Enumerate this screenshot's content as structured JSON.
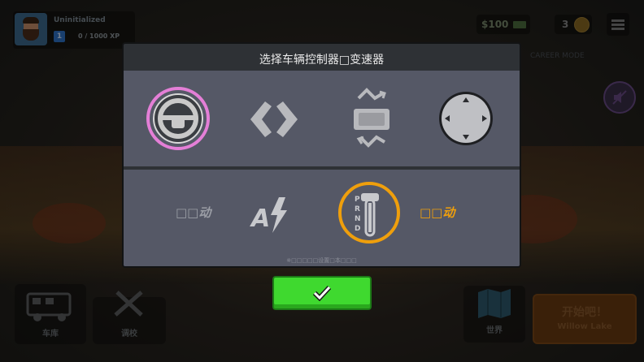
{
  "player": {
    "name": "Uninitialized",
    "level": "1",
    "xp": "0 / 1000 XP"
  },
  "currency": {
    "money": "$100",
    "coins": "3"
  },
  "side": {
    "text": "CAREER MODE"
  },
  "dialog": {
    "title": "选择车辆控制器□变速器",
    "steering_options": [
      "steering-wheel",
      "arrows",
      "tilt",
      "joystick"
    ],
    "manual_label": "□□动",
    "auto_label": "□□动",
    "hint": "※□□□□□设置□本□□□",
    "selected_steering": "steering-wheel",
    "selected_transmission": "auto"
  },
  "gear_letters": [
    "P",
    "R",
    "N",
    "D"
  ],
  "bottom": {
    "garage_label": "车库",
    "tune_label": "调校",
    "world_label": "世界",
    "go_line1": "开始吧！",
    "go_line2": "Willow Lake"
  },
  "colors": {
    "accent_pink": "#e47fd7",
    "accent_orange": "#ef9f0c",
    "confirm_green": "#3fd92f"
  }
}
